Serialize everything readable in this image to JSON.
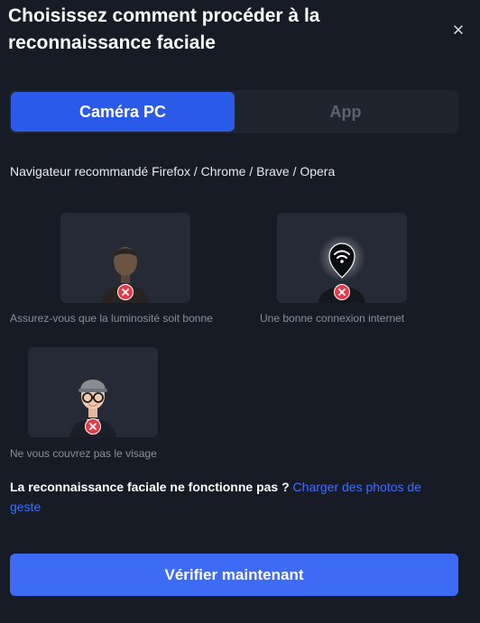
{
  "dialog": {
    "title": "Choisissez comment procéder à la reconnaissance faciale"
  },
  "tabs": [
    {
      "label": "Caméra PC",
      "selected": true
    },
    {
      "label": "App",
      "selected": false
    }
  ],
  "browser_note": "Navigateur recommandé Firefox / Chrome / Brave / Opera",
  "tips": [
    {
      "caption": "Assurez-vous que la luminosité soit bonne",
      "icon": "dark-person-icon"
    },
    {
      "caption": "Une bonne connexion internet",
      "icon": "no-wifi-person-icon"
    },
    {
      "caption": "Ne vous couvrez pas le visage",
      "icon": "covered-face-person-icon"
    }
  ],
  "fail": {
    "question": "La reconnaissance faciale ne fonctionne pas ?",
    "link": "Charger des photos de geste"
  },
  "verify_button": "Vérifier maintenant",
  "colors": {
    "background": "#171b26",
    "card": "#262a37",
    "accent": "#2b5ae8",
    "link": "#3d6fff",
    "error": "#e23b4a"
  }
}
